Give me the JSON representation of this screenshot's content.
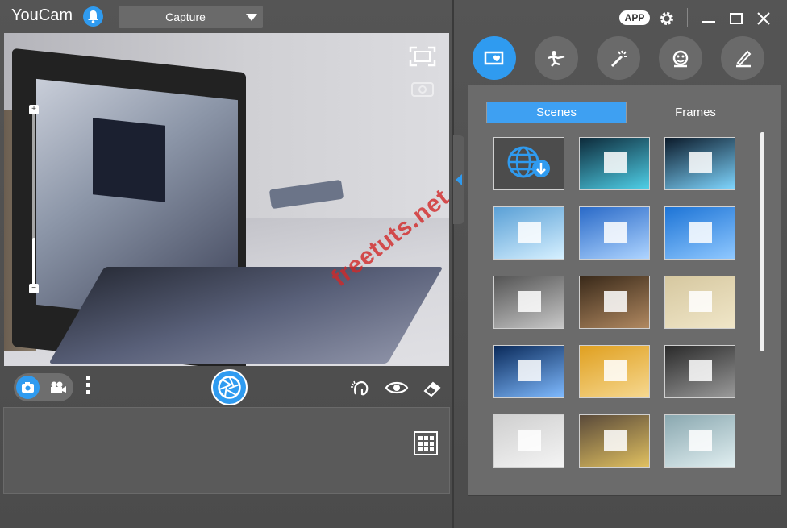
{
  "app": {
    "title": "YouCam"
  },
  "header": {
    "mode_select": "Capture",
    "app_button": "APP"
  },
  "preview": {
    "watermark": "freetuts.net",
    "zoom_plus": "+",
    "zoom_minus": "−",
    "zoom_level": 0.28
  },
  "effects": {
    "tabs": [
      "Scenes",
      "Frames"
    ],
    "active_tab": "Scenes",
    "categories": [
      "scenes-icon",
      "avatar-icon",
      "magic-wand-icon",
      "face-distortion-icon",
      "brush-icon"
    ]
  },
  "thumbnails": [
    {
      "name": "download-more-scenes",
      "colors": [
        "#3a3a3a",
        "#3a3a3a"
      ]
    },
    {
      "name": "scene-spotlight",
      "colors": [
        "#0d2a3a",
        "#4fd0e8"
      ]
    },
    {
      "name": "scene-bubble-room",
      "colors": [
        "#0b1a2a",
        "#7fd6ff"
      ]
    },
    {
      "name": "scene-blue-frame",
      "colors": [
        "#5aa0d6",
        "#d6f0ff"
      ]
    },
    {
      "name": "scene-billboard-sky",
      "colors": [
        "#2a6ac8",
        "#aed4ff"
      ]
    },
    {
      "name": "scene-balloon",
      "colors": [
        "#1d74d6",
        "#8fc8ff"
      ]
    },
    {
      "name": "scene-mall",
      "colors": [
        "#555555",
        "#c8c8c8"
      ]
    },
    {
      "name": "scene-hand-frame",
      "colors": [
        "#3a2a1a",
        "#b08860"
      ]
    },
    {
      "name": "scene-gallery-frame",
      "colors": [
        "#d6c8a0",
        "#f0e6c8"
      ]
    },
    {
      "name": "scene-blue-bubbles",
      "colors": [
        "#0a2a5a",
        "#7fbaff"
      ]
    },
    {
      "name": "scene-autumn-board",
      "colors": [
        "#e0a020",
        "#f6d890"
      ]
    },
    {
      "name": "scene-train-station",
      "colors": [
        "#2a2a2a",
        "#9a9a9a"
      ]
    },
    {
      "name": "scene-newspaper",
      "colors": [
        "#cfcfcf",
        "#f4f4f4"
      ]
    },
    {
      "name": "scene-city-billboard",
      "colors": [
        "#5a4a3a",
        "#e0c060"
      ]
    },
    {
      "name": "scene-window-climbers",
      "colors": [
        "#8aa8b0",
        "#e0eef0"
      ]
    }
  ],
  "theme": {
    "accent": "#2f9bf0",
    "panel": "#6b6b6b",
    "background": "#4f4f4f"
  }
}
